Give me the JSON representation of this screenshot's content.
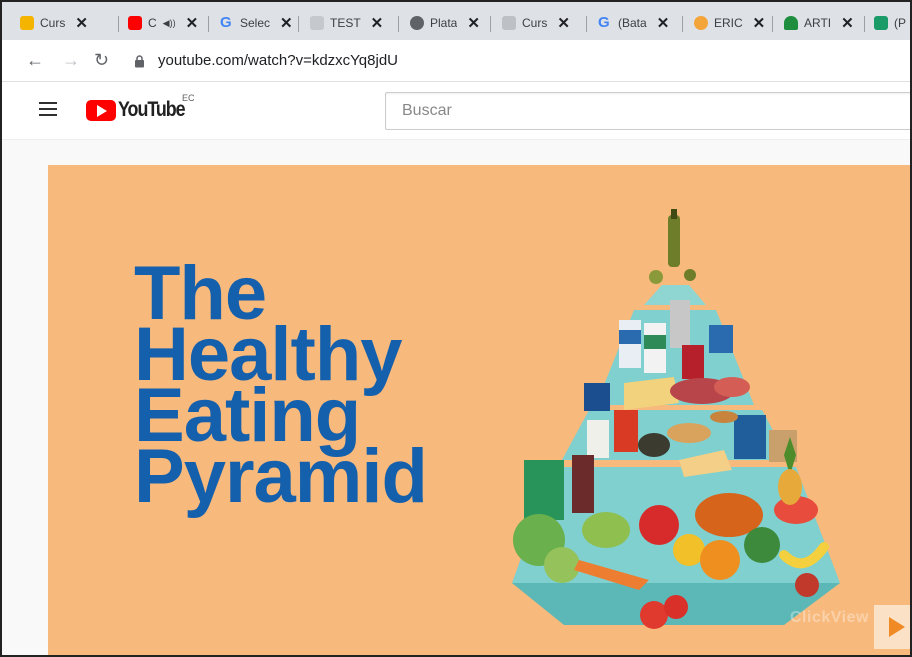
{
  "browser": {
    "tabs": [
      {
        "title": "Curs",
        "favicon": "flag-icon",
        "color": "#f5b400"
      },
      {
        "title": "C",
        "favicon": "youtube-icon",
        "color": "#ff0000",
        "audio": "◀))"
      },
      {
        "title": "Selec",
        "favicon": "google-icon",
        "color": "#4285f4"
      },
      {
        "title": "TEST",
        "favicon": "forms-icon",
        "color": "#9aa0a6"
      },
      {
        "title": "Plata",
        "favicon": "globe-icon",
        "color": "#5f6368"
      },
      {
        "title": "Curs",
        "favicon": "doc-icon",
        "color": "#9aa0a6"
      },
      {
        "title": "(Bata",
        "favicon": "google-icon",
        "color": "#4285f4"
      },
      {
        "title": "ERIC",
        "favicon": "eric-icon",
        "color": "#f4a53a"
      },
      {
        "title": "ARTI",
        "favicon": "tree-icon",
        "color": "#1e8e3e"
      },
      {
        "title": "(P",
        "favicon": "r-icon",
        "color": "#1a9b68"
      }
    ],
    "close_glyph": "✕",
    "url": "youtube.com/watch?v=kdzxcYq8jdU"
  },
  "youtube": {
    "logo_text": "YouTube",
    "country_code": "EC",
    "search_placeholder": "Buscar"
  },
  "video": {
    "title_lines": [
      "The",
      "Healthy",
      "Eating",
      "Pyramid"
    ],
    "watermark": "ClickView",
    "colors": {
      "background": "#f7b97c",
      "title": "#1560ac",
      "pyramid": "#7fd0cf"
    }
  }
}
